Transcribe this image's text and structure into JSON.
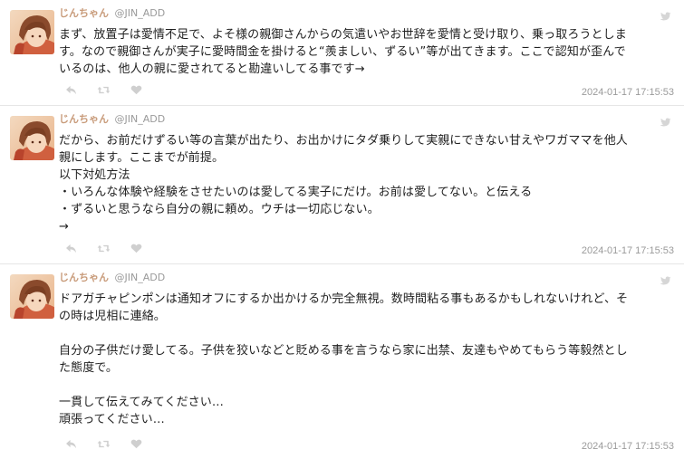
{
  "tweets": [
    {
      "author": {
        "display_name": "じんちゃん",
        "screen_name": "@JIN_ADD"
      },
      "text": "まず、放置子は愛情不足で、よそ様の親御さんからの気遣いやお世辞を愛情と受け取り、乗っ取ろうとしま\nす。なので親御さんが実子に愛時間金を掛けると“羨ましい、ずるい”等が出てきます。ここで認知が歪んで\nいるのは、他人の親に愛されてると勘違いしてる事です→",
      "timestamp": "2024-01-17 17:15:53"
    },
    {
      "author": {
        "display_name": "じんちゃん",
        "screen_name": "@JIN_ADD"
      },
      "text": "だから、お前だけずるい等の言葉が出たり、お出かけにタダ乗りして実親にできない甘えやワガママを他人\n親にします。ここまでが前提。\n以下対処方法\n・いろんな体験や経験をさせたいのは愛してる実子にだけ。お前は愛してない。と伝える\n・ずるいと思うなら自分の親に頼め。ウチは一切応じない。\n→",
      "timestamp": "2024-01-17 17:15:53"
    },
    {
      "author": {
        "display_name": "じんちゃん",
        "screen_name": "@JIN_ADD"
      },
      "text": "ドアガチャピンポンは通知オフにするか出かけるか完全無視。数時間粘る事もあるかもしれないけれど、そ\nの時は児相に連絡。\n\n自分の子供だけ愛してる。子供を狡いなどと貶める事を言うなら家に出禁、友達もやめてもらう等毅然とし\nた態度で。\n\n一貫して伝えてみてください…\n頑張ってください…",
      "timestamp": "2024-01-17 17:15:53"
    }
  ],
  "icons": {
    "reply": "reply-icon",
    "retweet": "retweet-icon",
    "like": "heart-icon",
    "bird": "bird-icon"
  },
  "colors": {
    "display_name": "#c89b7a",
    "meta_gray": "#9a9a9a",
    "icon_gray": "#cfcfcf",
    "divider": "#e6e6e6"
  }
}
